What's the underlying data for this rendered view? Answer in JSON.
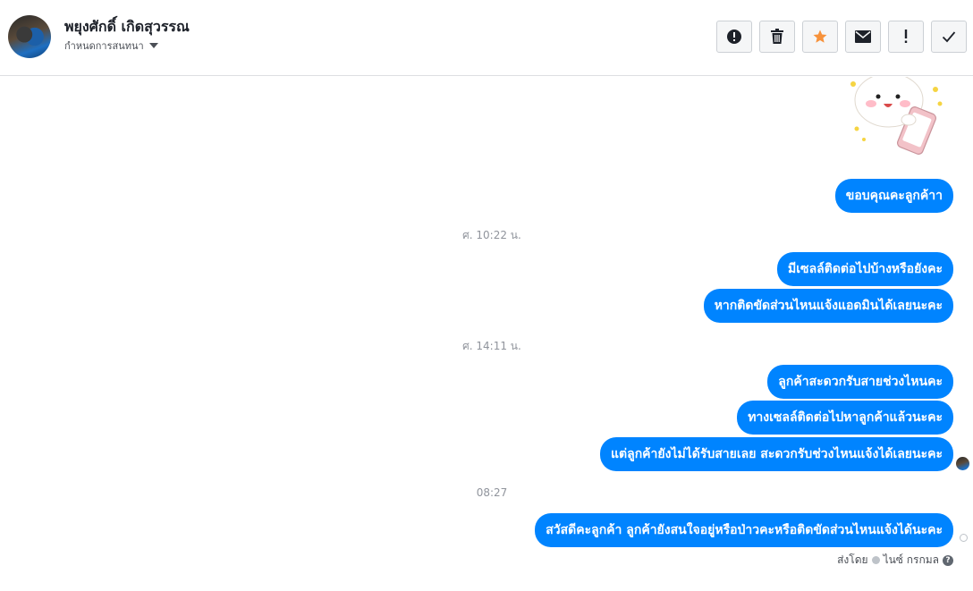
{
  "header": {
    "contact_name": "พยุงศักดิ์ เกิดสุวรรณ",
    "assign_label": "กำหนดการสนทนา"
  },
  "toolbar": {
    "buttons": [
      {
        "icon": "alert-circle-icon"
      },
      {
        "icon": "trash-icon"
      },
      {
        "icon": "star-icon",
        "color": "#f7923b"
      },
      {
        "icon": "envelope-icon"
      },
      {
        "icon": "exclamation-icon"
      },
      {
        "icon": "check-icon"
      }
    ]
  },
  "thread": {
    "sticker": "sticker-waving-character",
    "messages": [
      {
        "text": "ขอบคุณคะลูกค้าา"
      },
      {
        "timestamp": "ศ. 10:22 น."
      },
      {
        "text": "มีเซลล์ติดต่อไปบ้างหรือยังคะ"
      },
      {
        "text": "หากติดขัดส่วนไหนแจ้งแอดมินได้เลยนะคะ"
      },
      {
        "timestamp": "ศ. 14:11 น."
      },
      {
        "text": "ลูกค้าสะดวกรับสายช่วงไหนคะ"
      },
      {
        "text": "ทางเซลล์ติดต่อไปหาลูกค้าแล้วนะคะ"
      },
      {
        "text": "แต่ลูกค้ายังไม่ได้รับสายเลย สะดวกรับช่วงไหนแจ้งได้เลยนะคะ"
      },
      {
        "timestamp": "08:27"
      },
      {
        "text": "สวัสดีคะลูกค้า ลูกค้ายังสนใจอยู่หรือป่าวคะหรือติดขัดส่วนไหนแจ้งได้นะคะ"
      }
    ],
    "sent_by_label": "ส่งโดย",
    "sender_name": "ไนซ์ กรกมล",
    "help_glyph": "?"
  },
  "colors": {
    "bubble": "#0084ff",
    "timestamp": "#90949c"
  }
}
